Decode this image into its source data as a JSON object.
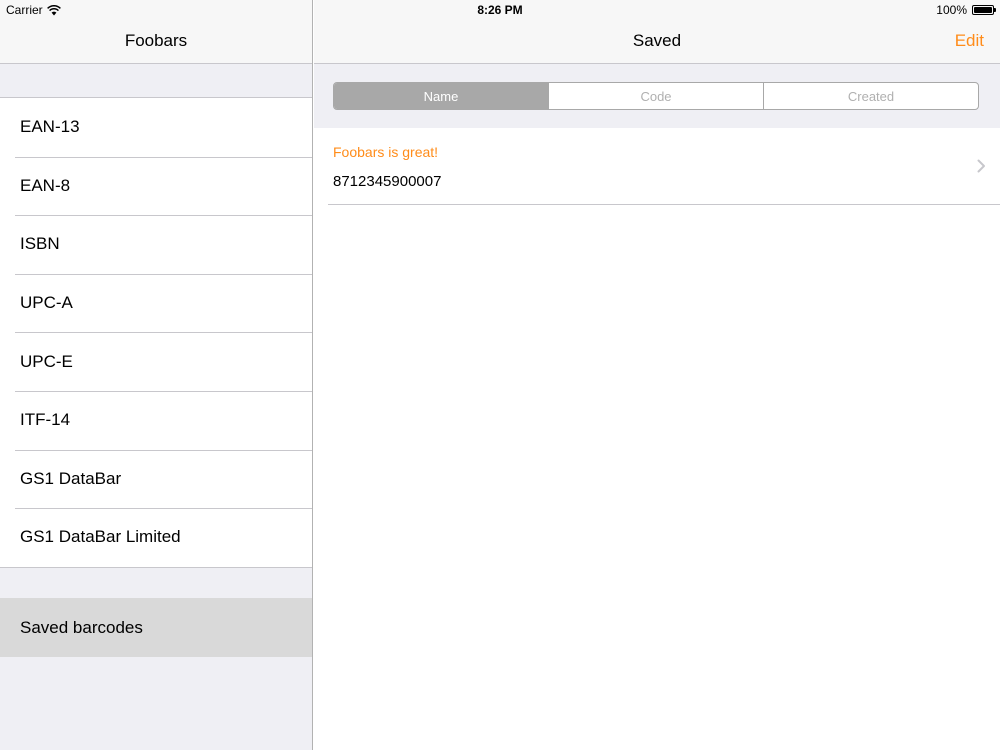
{
  "status_bar": {
    "carrier": "Carrier",
    "time": "8:26 PM",
    "battery": "100%"
  },
  "master": {
    "title": "Foobars",
    "barcode_types": [
      {
        "label": "EAN-13"
      },
      {
        "label": "EAN-8"
      },
      {
        "label": "ISBN"
      },
      {
        "label": "UPC-A"
      },
      {
        "label": "UPC-E"
      },
      {
        "label": "ITF-14"
      },
      {
        "label": "GS1 DataBar"
      },
      {
        "label": "GS1 DataBar Limited"
      }
    ],
    "saved_item": {
      "label": "Saved barcodes"
    }
  },
  "detail": {
    "title": "Saved",
    "edit_label": "Edit",
    "sort_segments": [
      {
        "label": "Name"
      },
      {
        "label": "Code"
      },
      {
        "label": "Created"
      }
    ],
    "items": [
      {
        "name": "Foobars is great!",
        "code": "8712345900007"
      }
    ]
  },
  "colors": {
    "accent": "#ff8c1a",
    "segment_selected": "#a8a8a8",
    "selected_row": "#d9d9d9"
  },
  "icons": {
    "wifi": "wifi-icon",
    "battery": "battery-icon",
    "chevron": "chevron-right-icon"
  }
}
